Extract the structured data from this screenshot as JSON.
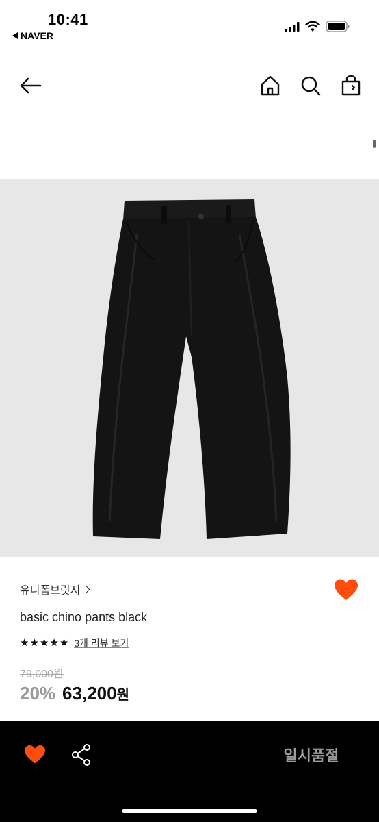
{
  "status_bar": {
    "time": "10:41",
    "back_app": "NAVER"
  },
  "nav": {
    "icons": [
      "back-arrow-icon",
      "home-icon",
      "search-icon",
      "shopping-bag-icon"
    ]
  },
  "product": {
    "image": "black-chino-pants",
    "brand": "유니폼브릿지",
    "name": "basic chino pants black",
    "rating_stars": 5,
    "review_link": "3개 리뷰 보기",
    "original_price": "79,000원",
    "discount": "20%",
    "sale_price_number": "63,200",
    "sale_price_unit": "원",
    "wished": true
  },
  "bottom_bar": {
    "status_button": "일시품절"
  },
  "colors": {
    "accent": "#ff4d0d",
    "image_bg": "#e7e7e7",
    "bottom_bar_bg": "#000000",
    "discount": "#9a9a9a"
  }
}
